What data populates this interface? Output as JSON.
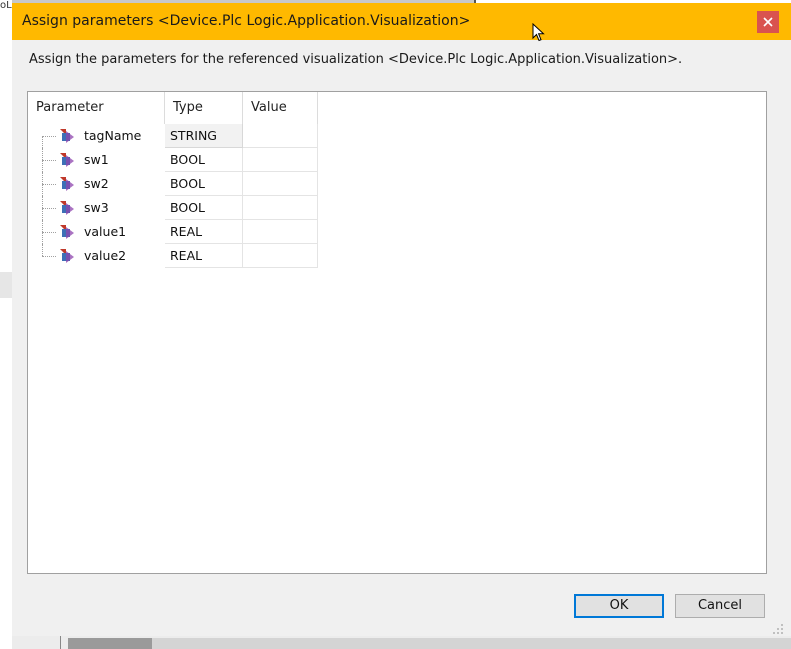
{
  "background": {
    "corner_text": "oL"
  },
  "dialog": {
    "title": "Assign parameters <Device.Plc Logic.Application.Visualization>",
    "close_icon": "close-icon",
    "description": "Assign the parameters for the referenced visualization <Device.Plc Logic.Application.Visualization>.",
    "table": {
      "headers": {
        "parameter": "Parameter",
        "type": "Type",
        "value": "Value"
      },
      "rows": [
        {
          "name": "tagName",
          "type": "STRING",
          "value": ""
        },
        {
          "name": "sw1",
          "type": "BOOL",
          "value": ""
        },
        {
          "name": "sw2",
          "type": "BOOL",
          "value": ""
        },
        {
          "name": "sw3",
          "type": "BOOL",
          "value": ""
        },
        {
          "name": "value1",
          "type": "REAL",
          "value": ""
        },
        {
          "name": "value2",
          "type": "REAL",
          "value": ""
        }
      ]
    },
    "buttons": {
      "ok": "OK",
      "cancel": "Cancel"
    }
  },
  "colors": {
    "titlebar": "#ffb900",
    "close": "#d9534f",
    "ok_border": "#0078d7"
  }
}
